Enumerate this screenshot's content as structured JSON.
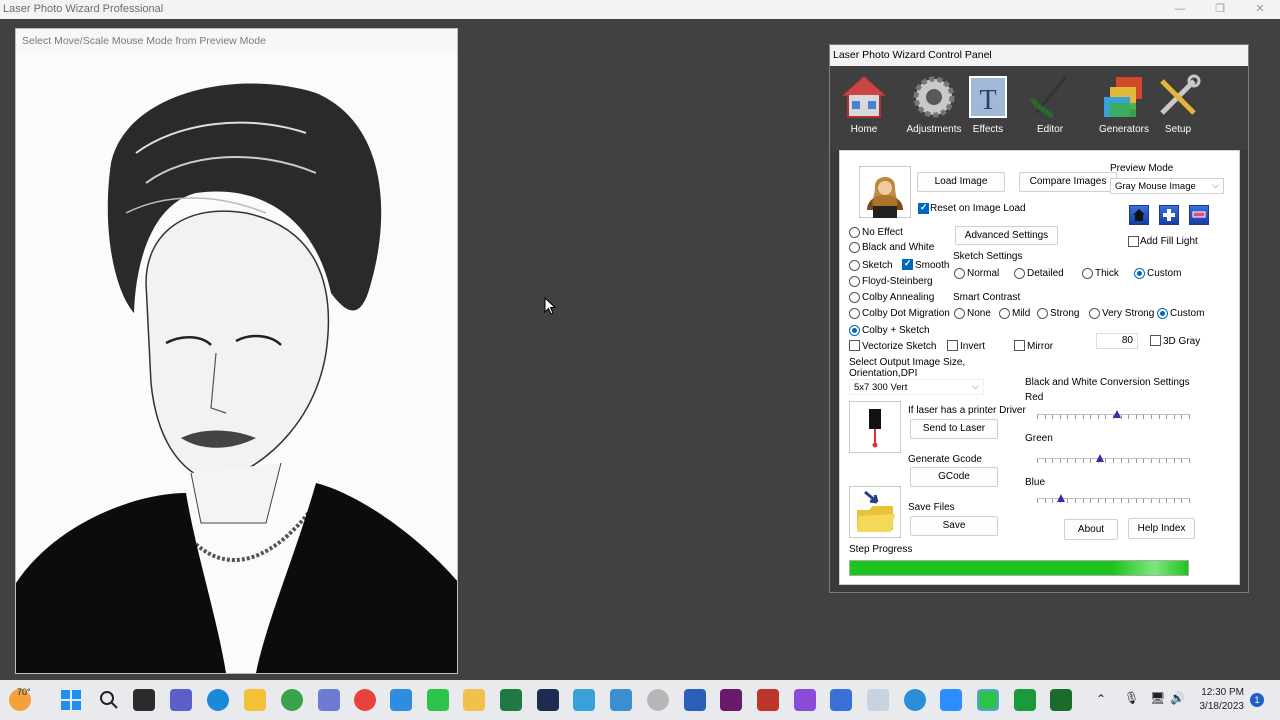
{
  "app": {
    "title": "Laser Photo Wizard Professional"
  },
  "preview": {
    "hint": "Select Move/Scale Mouse Mode from Preview Mode"
  },
  "control_panel": {
    "title": "Laser Photo Wizard Control Panel",
    "toolbar": [
      {
        "label": "Home",
        "icon": "home-icon"
      },
      {
        "label": "Adjustments",
        "icon": "gear-icon"
      },
      {
        "label": "Effects",
        "icon": "effects-icon"
      },
      {
        "label": "Editor",
        "icon": "editor-icon"
      },
      {
        "label": "Generators",
        "icon": "generators-icon"
      },
      {
        "label": "Setup",
        "icon": "setup-icon"
      }
    ],
    "load_image": "Load Image",
    "compare_images": "Compare Images",
    "reset_on_load": "Reset on Image Load",
    "preview_mode_label": "Preview Mode",
    "preview_mode_value": "Gray Mouse Image",
    "add_fill_light": "Add Fill Light",
    "effects": {
      "no_effect": "No Effect",
      "black_white": "Black and White",
      "sketch": "Sketch",
      "smooth": "Smooth",
      "floyd": "Floyd-Steinberg",
      "colby_annealing": "Colby Annealing",
      "colby_dot": "Colby Dot Migration",
      "colby_sketch": "Colby + Sketch",
      "vectorize": "Vectorize Sketch",
      "invert": "Invert",
      "mirror": "Mirror"
    },
    "advanced_settings": "Advanced Settings",
    "sketch_settings": {
      "label": "Sketch Settings",
      "normal": "Normal",
      "detailed": "Detailed",
      "thick": "Thick",
      "custom": "Custom"
    },
    "smart_contrast": {
      "label": "Smart Contrast",
      "none": "None",
      "mild": "Mild",
      "strong": "Strong",
      "very_strong": "Very Strong",
      "custom": "Custom"
    },
    "gray_value": "80",
    "gray_label": "3D Gray",
    "output_size_label": "Select Output Image Size, Orientation,DPI",
    "output_size_value": "5x7 300 Vert",
    "bw_conversion": "Black and White Conversion Settings",
    "red": "Red",
    "green": "Green",
    "blue": "Blue",
    "red_level": 0.52,
    "green_level": 0.41,
    "blue_level": 0.16,
    "printer_driver": "If laser has a printer Driver",
    "send_to_laser": "Send to Laser",
    "generate_gcode": "Generate Gcode",
    "gcode": "GCode",
    "save_files": "Save Files",
    "save": "Save",
    "about": "About",
    "help_index": "Help Index",
    "step_progress": "Step Progress",
    "progress_value": 1.0
  },
  "taskbar": {
    "weather": "70°",
    "time": "12:30 PM",
    "date": "3/18/2023",
    "notifications": "1"
  },
  "colors": {
    "progress": "#1ec41e",
    "accent": "#0067c0"
  }
}
